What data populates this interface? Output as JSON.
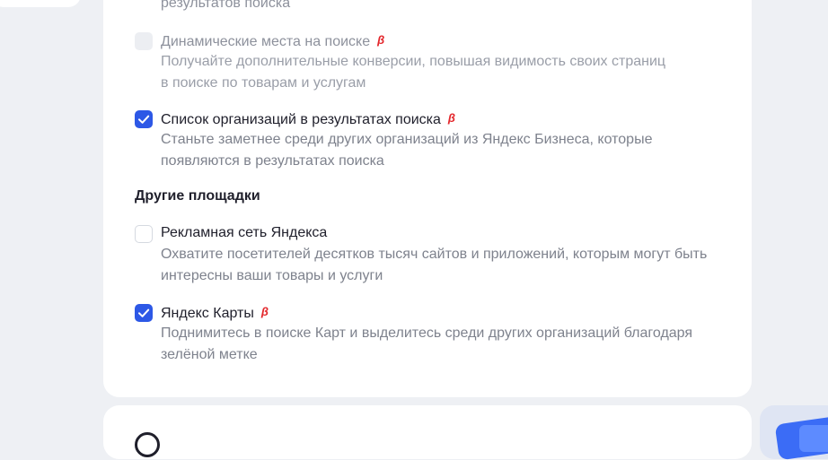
{
  "search_section": {
    "truncated_line": "результатов поиска",
    "options": [
      {
        "title": "Динамические места на поиске",
        "beta": "β",
        "desc_lines": [
          "Получайте дополнительные конверсии, повышая видимость своих страниц",
          "в поиске по товарам и услугам"
        ],
        "state": "disabled"
      },
      {
        "title": "Список организаций в результатах поиска",
        "beta": "β",
        "desc_lines": [
          "Станьте заметнее среди других организаций из Яндекс Бизнеса, которые",
          "появляются в результатах поиска"
        ],
        "state": "checked"
      }
    ]
  },
  "other_section": {
    "heading": "Другие площадки",
    "options": [
      {
        "title": "Рекламная сеть Яндекса",
        "desc_lines": [
          "Охватите посетителей десятков тысяч сайтов и приложений, которым могут быть",
          "интересны ваши товары и услуги"
        ],
        "state": "unchecked"
      },
      {
        "title": "Яндекс Карты",
        "beta": "β",
        "desc_lines": [
          "Поднимитесь в поиске Карт и выделитесь среди других организаций благодаря",
          "зелёной метке"
        ],
        "state": "checked"
      }
    ]
  },
  "colors": {
    "accent": "#2d58e6",
    "beta": "#e3262b",
    "page_bg": "#eef0f4",
    "card_bg": "#ffffff"
  }
}
